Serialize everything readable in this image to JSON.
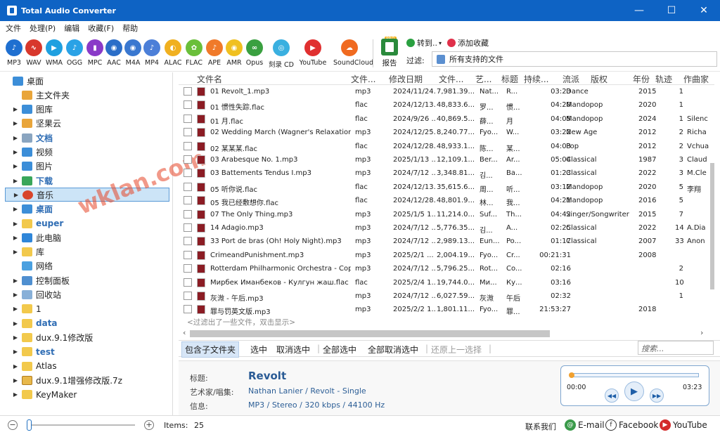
{
  "window": {
    "title": "Total Audio Converter",
    "min": "—",
    "max": "☐",
    "close": "✕"
  },
  "menu": [
    "文件",
    "处理(P)",
    "编辑",
    "收藏(F)",
    "帮助"
  ],
  "formats": [
    {
      "label": "MP3",
      "color": "#1f6fd0"
    },
    {
      "label": "WAV",
      "color": "#d8382c"
    },
    {
      "label": "WMA",
      "color": "#1fa0e0"
    },
    {
      "label": "OGG",
      "color": "#2aa2e6"
    },
    {
      "label": "MPC",
      "color": "#8a3ac8"
    },
    {
      "label": "AAC",
      "color": "#2b6ec8"
    },
    {
      "label": "M4A",
      "color": "#3a78d0"
    },
    {
      "label": "MP4",
      "color": "#4c7fd8"
    },
    {
      "label": "ALAC",
      "color": "#f0b020"
    },
    {
      "label": "FLAC",
      "color": "#6abf3a"
    },
    {
      "label": "APE",
      "color": "#f07a2a"
    },
    {
      "label": "AMR",
      "color": "#f0c020"
    },
    {
      "label": "Opus",
      "color": "#3aa040"
    },
    {
      "label": "刻录 CD",
      "color": "#3ab0e0"
    },
    {
      "label": "YouTube",
      "color": "#e03030"
    },
    {
      "label": "SoundCloud",
      "color": "#f06a20"
    }
  ],
  "toolbar": {
    "report": "报告",
    "pro": "PRO",
    "convert_to": "转到..",
    "add_favorite": "添加收藏",
    "filter_label": "过滤:",
    "filter_value": "所有支持的文件"
  },
  "tree": [
    {
      "label": "桌面",
      "icon": "desktop",
      "level": 0,
      "style": ""
    },
    {
      "label": "主文件夹",
      "icon": "home",
      "level": 1,
      "style": ""
    },
    {
      "label": "图库",
      "icon": "gallery",
      "level": 1,
      "style": "",
      "arrow": true
    },
    {
      "label": "坚果云",
      "icon": "nut-cloud",
      "level": 1,
      "style": "",
      "arrow": true
    },
    {
      "label": "文档",
      "icon": "documents",
      "level": 1,
      "style": "boldblue",
      "arrow": true
    },
    {
      "label": "视频",
      "icon": "video",
      "level": 1,
      "style": "",
      "arrow": true
    },
    {
      "label": "图片",
      "icon": "pictures",
      "level": 1,
      "style": "",
      "arrow": true
    },
    {
      "label": "下载",
      "icon": "download",
      "level": 1,
      "style": "boldblue",
      "arrow": true
    },
    {
      "label": "音乐",
      "icon": "music",
      "level": 1,
      "style": "",
      "arrow": true,
      "selected": true
    },
    {
      "label": "桌面",
      "icon": "desktop",
      "level": 1,
      "style": "boldblue",
      "arrow": true
    },
    {
      "label": "euper",
      "icon": "folder",
      "level": 1,
      "style": "boldblue",
      "arrow": true
    },
    {
      "label": "此电脑",
      "icon": "computer",
      "level": 1,
      "style": "",
      "arrow": true
    },
    {
      "label": "库",
      "icon": "library",
      "level": 1,
      "style": "",
      "arrow": true
    },
    {
      "label": "网络",
      "icon": "network",
      "level": 1,
      "style": ""
    },
    {
      "label": "控制面板",
      "icon": "control-panel",
      "level": 1,
      "style": "",
      "arrow": true
    },
    {
      "label": "回收站",
      "icon": "recycle-bin",
      "level": 1,
      "style": "",
      "arrow": true
    },
    {
      "label": "1",
      "icon": "folder",
      "level": 1,
      "style": "",
      "arrow": true
    },
    {
      "label": "data",
      "icon": "folder",
      "level": 1,
      "style": "boldblue",
      "arrow": true
    },
    {
      "label": "dux.9.1修改版",
      "icon": "folder",
      "level": 1,
      "style": "",
      "arrow": true
    },
    {
      "label": "test",
      "icon": "folder",
      "level": 1,
      "style": "boldblue",
      "arrow": true
    },
    {
      "label": "Atlas",
      "icon": "folder",
      "level": 1,
      "style": "",
      "arrow": true
    },
    {
      "label": "dux.9.1增强修改版.7z",
      "icon": "zip",
      "level": 1,
      "style": "",
      "arrow": true
    },
    {
      "label": "KeyMaker",
      "icon": "folder",
      "level": 1,
      "style": "",
      "arrow": true
    }
  ],
  "columns": [
    "文件名",
    "文件...",
    "修改日期",
    "文件...",
    "艺...",
    "标题",
    "持续...",
    "流派",
    "版权",
    "年份",
    "轨迹",
    "作曲家"
  ],
  "files": [
    [
      "01 Revolt_1.mp3",
      "mp3",
      "2024/11/24...",
      "7,981.39...",
      "Nat...",
      "R...",
      "03:23",
      "Dance",
      "",
      "2015",
      "1",
      ""
    ],
    [
      "01 惯性失踪.flac",
      "flac",
      "2024/12/13...",
      "48,833.6...",
      "罗...",
      "惯...",
      "04:20",
      "Mandopop",
      "",
      "2020",
      "1",
      ""
    ],
    [
      "01 月.flac",
      "flac",
      "2024/9/26 ...",
      "40,869.5...",
      "薛...",
      "月",
      "04:05",
      "Mandopop",
      "",
      "2024",
      "1",
      "Silenc"
    ],
    [
      "02 Wedding March (Wagner's Relaxation M...",
      "mp3",
      "2024/12/25...",
      "8,240.77...",
      "Fyo...",
      "W...",
      "03:22",
      "New Age",
      "",
      "2012",
      "2",
      "Richa"
    ],
    [
      "02 某某某.flac",
      "flac",
      "2024/12/28...",
      "48,933.1...",
      "陈...",
      "某...",
      "04:03",
      "Pop",
      "",
      "2012",
      "2",
      "Vchua"
    ],
    [
      "03 Arabesque No. 1.mp3",
      "mp3",
      "2025/1/13 ...",
      "12,109.1...",
      "Ber...",
      "Ar...",
      "05:04",
      "Classical",
      "",
      "1987",
      "3",
      "Claud"
    ],
    [
      "03 Battements Tendus I.mp3",
      "mp3",
      "2024/7/12 ...",
      "3,348.81...",
      "김...",
      "Ba...",
      "01:23",
      "Classical",
      "",
      "2022",
      "3",
      "M.Cle"
    ],
    [
      "05 听你说.flac",
      "flac",
      "2024/12/13...",
      "35,615.6...",
      "周...",
      "听...",
      "03:12",
      "Mandopop",
      "",
      "2020",
      "5",
      "李翔"
    ],
    [
      "05 我已经敷想你.flac",
      "flac",
      "2024/12/28...",
      "48,801.9...",
      "林...",
      "我...",
      "04:21",
      "Mandopop",
      "",
      "2016",
      "5",
      ""
    ],
    [
      "07 The Only Thing.mp3",
      "mp3",
      "2025/1/5 1...",
      "11,214.0...",
      "Suf...",
      "Th...",
      "04:42",
      "Singer/Songwriter",
      "",
      "2015",
      "7",
      ""
    ],
    [
      "14 Adagio.mp3",
      "mp3",
      "2024/7/12 ...",
      "5,776.35...",
      "김...",
      "A...",
      "02:25",
      "Classical",
      "",
      "2022",
      "14",
      "A.Dia"
    ],
    [
      "33 Port de bras (Oh! Holy Night).mp3",
      "mp3",
      "2024/7/12 ...",
      "2,989.13...",
      "Eun...",
      "Po...",
      "01:17",
      "Classical",
      "",
      "2007",
      "33",
      "Anon"
    ],
    [
      "CrimeandPunishment.mp3",
      "mp3",
      "2025/2/1 ...",
      "2,004.19...",
      "Fyo...",
      "Cr...",
      "00:21:31",
      "",
      "",
      "2008",
      "",
      ""
    ],
    [
      "Rotterdam Philharmonic Orchestra - Coppel...",
      "mp3",
      "2024/7/12 ...",
      "5,796.25...",
      "Rot...",
      "Co...",
      "02:16",
      "",
      "",
      "",
      "2",
      ""
    ],
    [
      "Мирбек Иманбеков - Кулгун жаш.flac",
      "flac",
      "2025/2/4 1...",
      "19,744.0...",
      "Ми...",
      "Ку...",
      "03:16",
      "",
      "",
      "",
      "10",
      ""
    ],
    [
      "灰溦 - 午后.mp3",
      "mp3",
      "2024/7/12 ...",
      "6,027.59...",
      "灰溦",
      "午后",
      "02:32",
      "",
      "",
      "",
      "1",
      ""
    ],
    [
      "罪与罚英文版.mp3",
      "mp3",
      "2025/2/2 1...",
      "1,801.11...",
      "Fyo...",
      "罪...",
      "21:53:27",
      "",
      "",
      "2018",
      "",
      ""
    ]
  ],
  "filtered_note": "<过滤出了一些文件，双击显示>",
  "selection_bar": [
    "包含子文件夹",
    "选中",
    "取消选中",
    "全部选中",
    "全部取消选中",
    "还原上一选择"
  ],
  "search_placeholder": "搜索...",
  "info": {
    "title_label": "标题:",
    "title": "Revolt",
    "artist_label": "艺术家/唱集:",
    "artist": "Nathan Lanier / Revolt - Single",
    "info_label": "信息:",
    "info": "MP3 / Stereo / 320 kbps / 44100 Hz"
  },
  "player": {
    "current": "00:00",
    "total": "03:23",
    "progress": 0
  },
  "status": {
    "items_label": "Items:",
    "items_count": "25",
    "contact": "联系我们",
    "email": "E-mail",
    "facebook": "Facebook",
    "youtube": "YouTube"
  },
  "watermark": "wklan.com"
}
